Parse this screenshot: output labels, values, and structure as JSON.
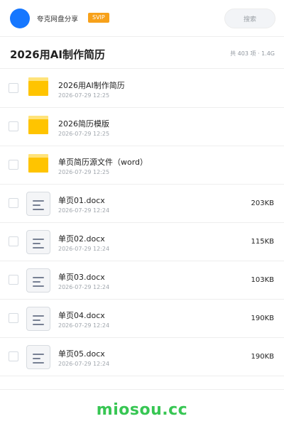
{
  "header": {
    "brand": "夸克网盘分享",
    "badge": "SVIP",
    "search_placeholder": "搜索"
  },
  "folder": {
    "title": "2026用AI制作简历",
    "summary": "共 403 项 · 1.4G"
  },
  "files": [
    {
      "type": "folder",
      "name": "2026用AI制作简历",
      "date": "2026-07-29 12:25",
      "size": ""
    },
    {
      "type": "folder",
      "name": "2026简历模版",
      "date": "2026-07-29 12:25",
      "size": ""
    },
    {
      "type": "folder",
      "name": "单页简历源文件（word）",
      "date": "2026-07-29 12:25",
      "size": ""
    },
    {
      "type": "doc",
      "name": "单页01.docx",
      "date": "2026-07-29 12:24",
      "size": "203KB"
    },
    {
      "type": "doc",
      "name": "单页02.docx",
      "date": "2026-07-29 12:24",
      "size": "115KB"
    },
    {
      "type": "doc",
      "name": "单页03.docx",
      "date": "2026-07-29 12:24",
      "size": "103KB"
    },
    {
      "type": "doc",
      "name": "单页04.docx",
      "date": "2026-07-29 12:24",
      "size": "190KB"
    },
    {
      "type": "doc",
      "name": "单页05.docx",
      "date": "2026-07-29 12:24",
      "size": "190KB"
    }
  ],
  "footer": {
    "watermark": "miosou.cc"
  },
  "colors": {
    "accent": "#1677ff",
    "badge": "#f7a11a",
    "folder": "#ffc400",
    "watermark": "#37c653"
  }
}
